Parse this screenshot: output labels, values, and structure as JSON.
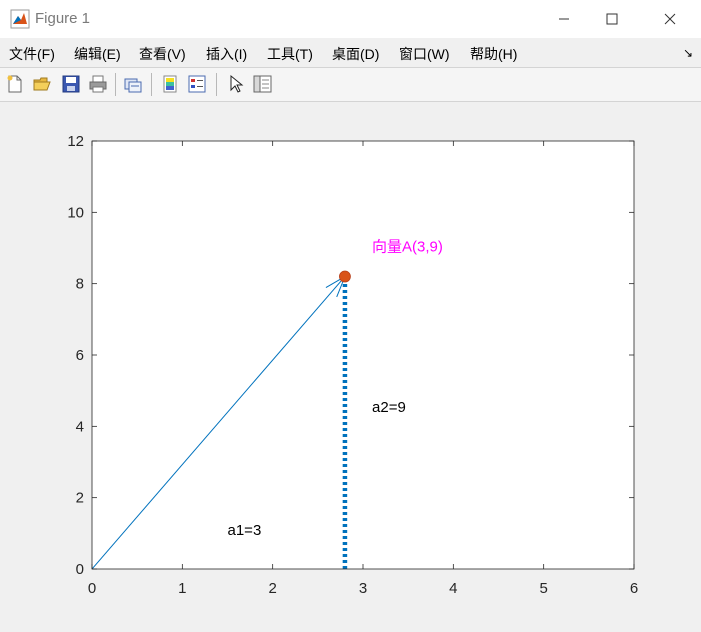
{
  "window": {
    "title": "Figure 1"
  },
  "menu": {
    "items": [
      "文件(F)",
      "编辑(E)",
      "查看(V)",
      "插入(I)",
      "工具(T)",
      "桌面(D)",
      "窗口(W)",
      "帮助(H)"
    ]
  },
  "toolbar": {
    "buttons": [
      "new-figure-icon",
      "open-file-icon",
      "save-icon",
      "print-icon",
      "link-plot-icon",
      "colorbar-icon",
      "legend-icon",
      "pointer-icon",
      "property-inspector-icon"
    ]
  },
  "chart_data": {
    "type": "line",
    "xlim": [
      0,
      6
    ],
    "ylim": [
      0,
      12
    ],
    "xticks": [
      "0",
      "1",
      "2",
      "3",
      "4",
      "5",
      "6"
    ],
    "yticks": [
      "0",
      "2",
      "4",
      "6",
      "8",
      "10",
      "12"
    ],
    "grid": false,
    "series": [
      {
        "kind": "arrow",
        "x": [
          0,
          2.8
        ],
        "y": [
          0,
          8.2
        ],
        "color": "#0072bd"
      },
      {
        "kind": "dotted-line",
        "x": [
          2.8,
          2.8
        ],
        "y": [
          0,
          8.2
        ],
        "color": "#0072bd"
      },
      {
        "kind": "marker",
        "x": [
          2.8
        ],
        "y": [
          8.2
        ],
        "color": "#d95319"
      }
    ],
    "annotations": [
      {
        "text": "向量A(3,9)",
        "x": 3.1,
        "y": 8.9,
        "color": "#ff00ff"
      },
      {
        "text": "a2=9",
        "x": 3.1,
        "y": 4.4,
        "color": "#000000"
      },
      {
        "text": "a1=3",
        "x": 1.5,
        "y": 0.95,
        "color": "#000000"
      }
    ]
  }
}
